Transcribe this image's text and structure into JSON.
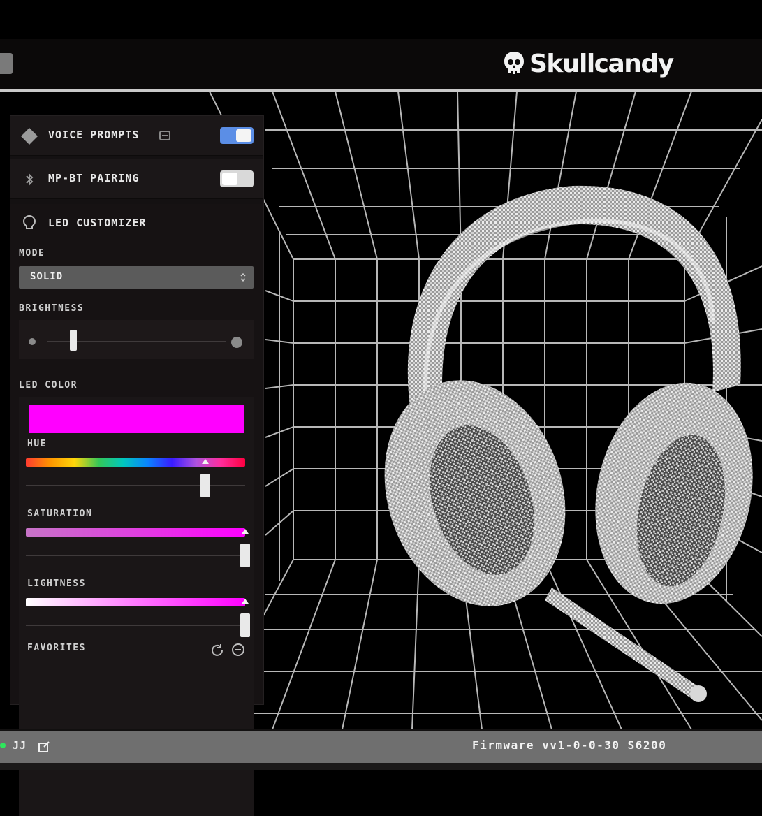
{
  "header": {
    "brand_name": "Skullcandy",
    "brand_icon": "skull-logo-icon",
    "back_icon": "back-icon"
  },
  "settings": {
    "voice_prompts": {
      "label": "VOICE PROMPTS",
      "icon": "diamond-icon",
      "info_icon": "info-icon",
      "enabled": true
    },
    "mp_bt_pairing": {
      "label": "MP-BT PAIRING",
      "icon": "bluetooth-icon",
      "enabled": false
    },
    "led_customizer": {
      "title": "LED CUSTOMIZER",
      "icon": "lightbulb-icon",
      "mode_label": "MODE",
      "mode_value": "SOLID",
      "brightness_label": "BRIGHTNESS",
      "brightness_value": 0.15,
      "led_color_label": "LED COLOR",
      "led_color": "#ff00ff",
      "hue_label": "HUE",
      "hue_value": 0.82,
      "saturation_label": "SATURATION",
      "saturation_value": 1.0,
      "lightness_label": "LIGHTNESS",
      "lightness_value": 1.0,
      "favorites_label": "FAVORITES",
      "favorites_icons": [
        "reset-icon",
        "add-icon"
      ]
    }
  },
  "footer": {
    "status_text": "JJ",
    "status_color": "#2ee65c",
    "edit_icon": "edit-icon",
    "firmware": "Firmware vv1-0-0-30 S6200"
  },
  "colors": {
    "accent_toggle": "#5b8ee6",
    "led": "#ff00ff"
  }
}
